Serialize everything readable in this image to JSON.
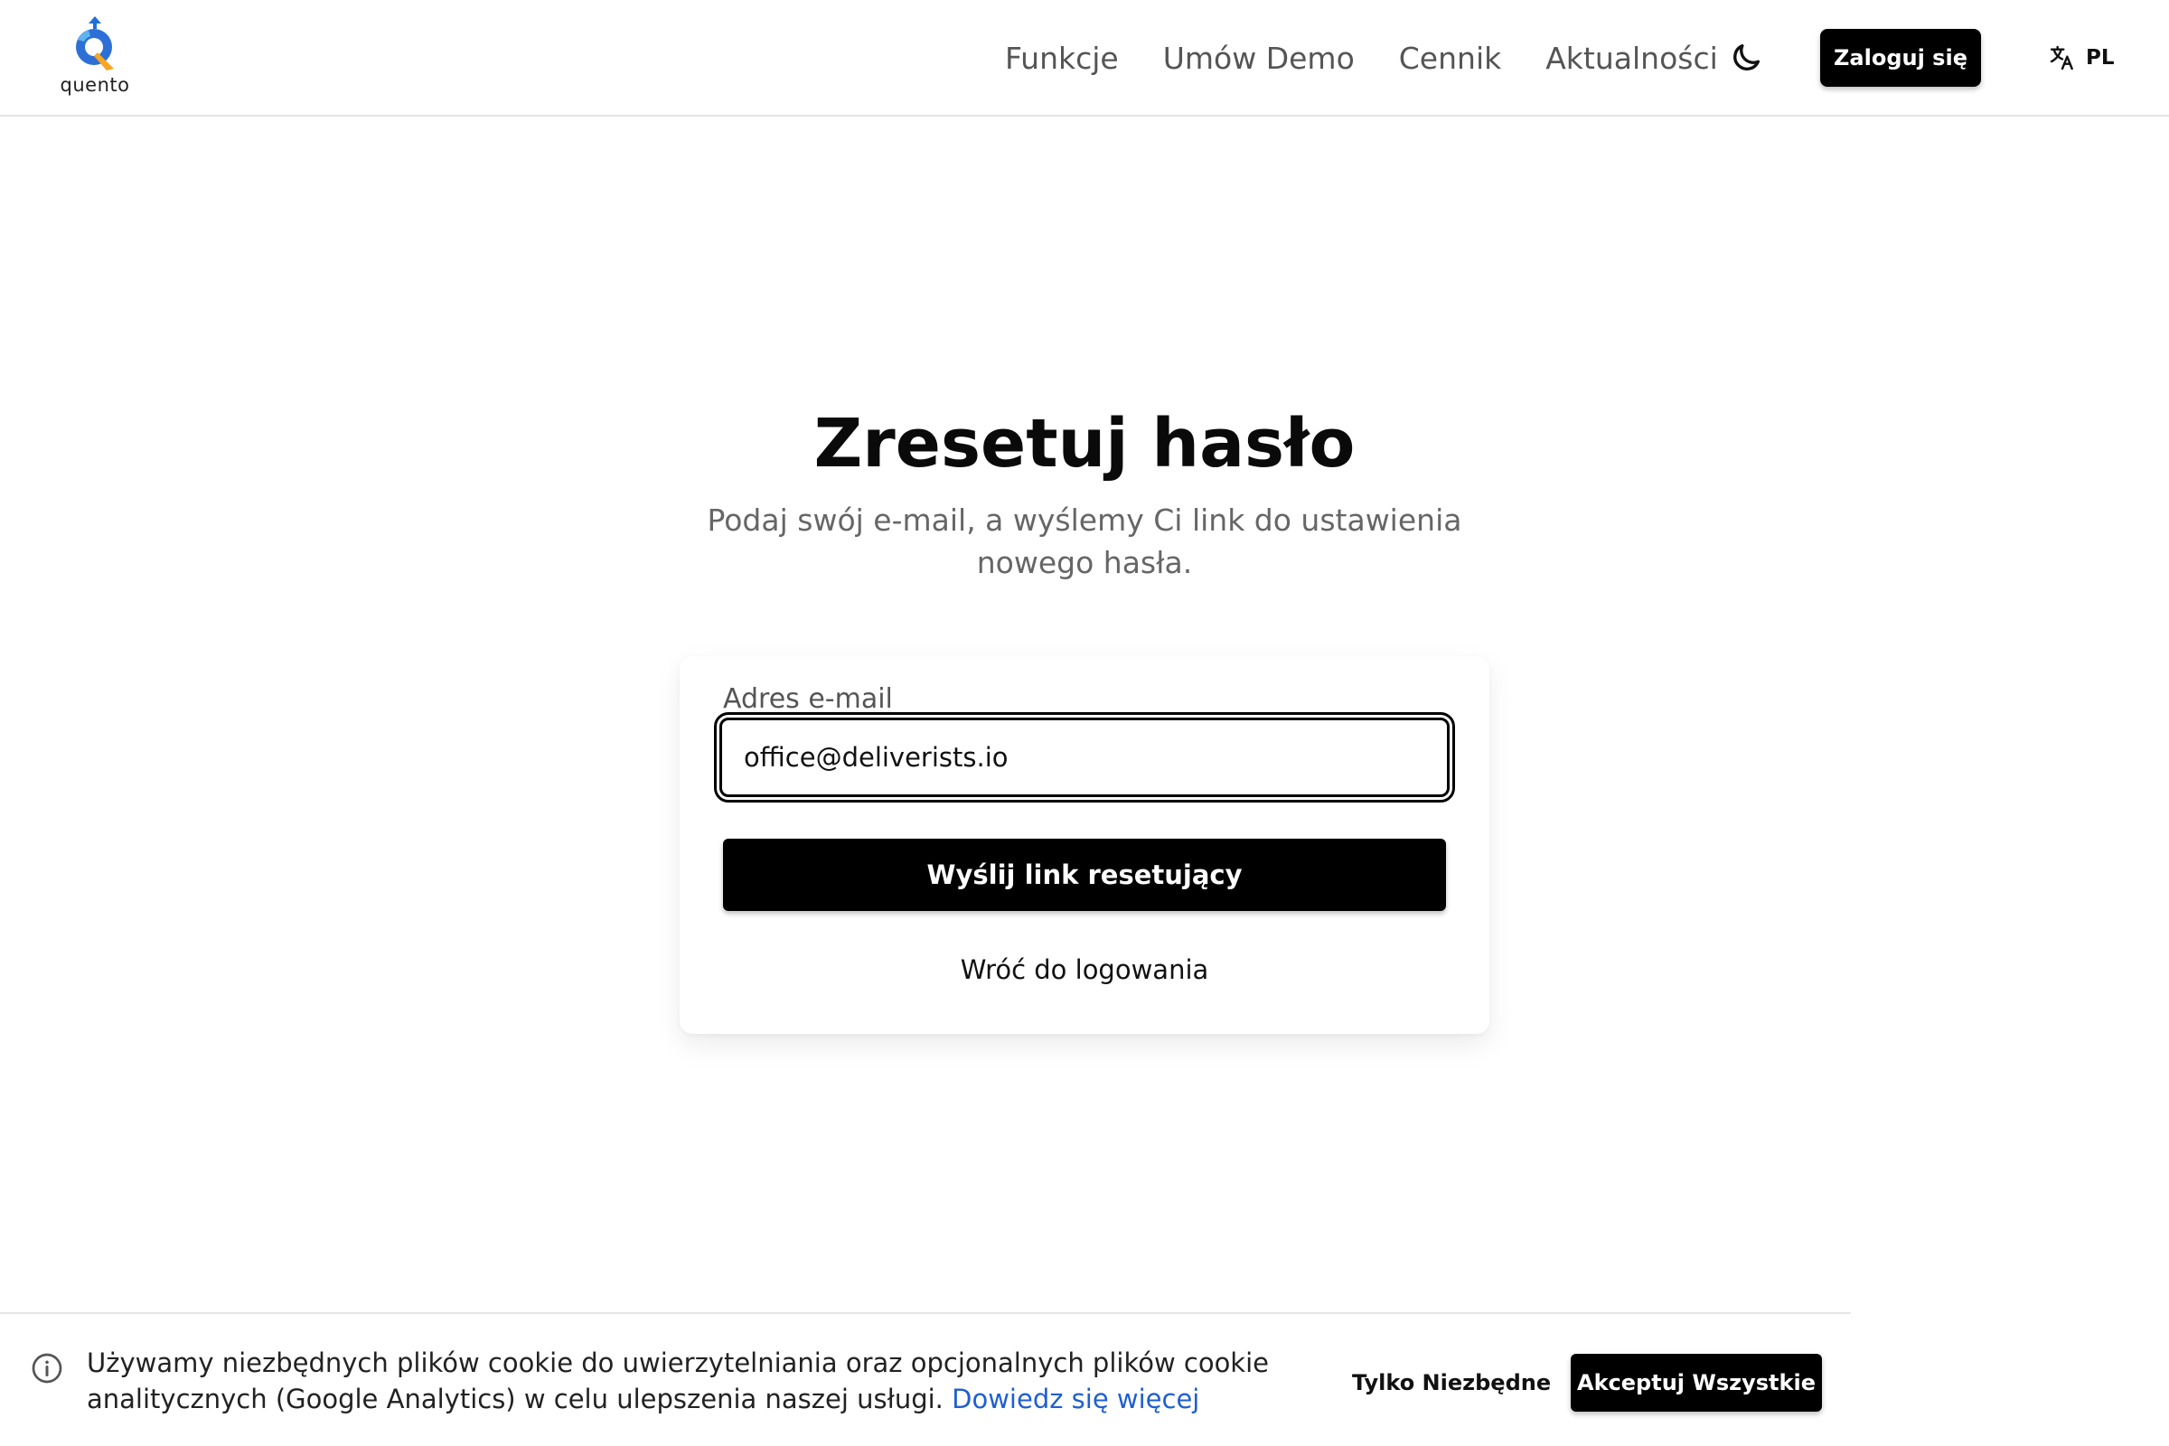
{
  "header": {
    "logo_text": "quento",
    "nav": [
      {
        "label": "Funkcje"
      },
      {
        "label": "Umów Demo"
      },
      {
        "label": "Cennik"
      },
      {
        "label": "Aktualności"
      }
    ],
    "theme_toggle_icon": "moon-icon",
    "login_label": "Zaloguj się",
    "language_icon": "translate-icon",
    "language_code": "PL"
  },
  "main": {
    "title": "Zresetuj hasło",
    "subtitle": "Podaj swój e-mail, a wyślemy Ci link do ustawienia nowego hasła.",
    "form": {
      "email_label": "Adres e-mail",
      "email_value": "office@deliverists.io",
      "submit_label": "Wyślij link resetujący",
      "back_label": "Wróć do logowania"
    }
  },
  "cookie_banner": {
    "icon": "info-icon",
    "text": "Używamy niezbędnych plików cookie do uwierzytelniania oraz opcjonalnych plików cookie analitycznych (Google Analytics) w celu ulepszenia naszej usługi.",
    "link_label": "Dowiedz się więcej",
    "essential_label": "Tylko Niezbędne",
    "accept_label": "Akceptuj Wszystkie"
  },
  "colors": {
    "primary": "#000000",
    "link": "#1f5fd1",
    "muted_text": "#666666",
    "logo_blue": "#2d6fd6",
    "logo_orange": "#f5a623"
  }
}
